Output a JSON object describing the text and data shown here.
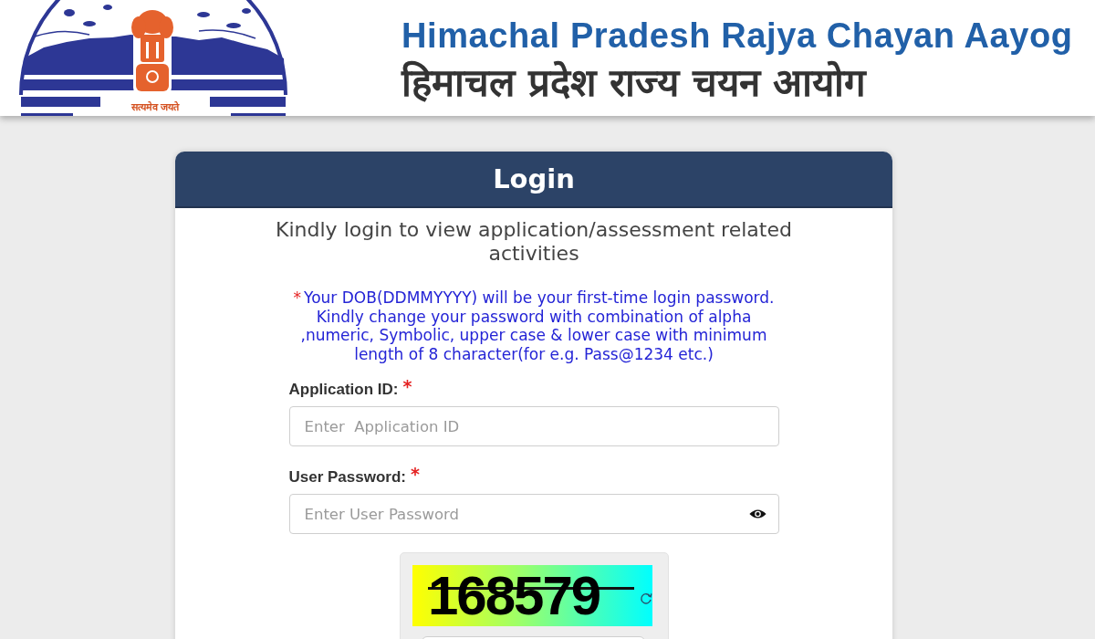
{
  "header": {
    "logo_motto": "सत्यमेव जयते",
    "title": "Himachal Pradesh Rajya Chayan Aayog",
    "title_hindi": "हिमाचल प्रदेश राज्य चयन आयोग"
  },
  "login_card": {
    "title": "Login",
    "subtitle": "Kindly login to view application/assessment related activities",
    "note": {
      "marker": "*",
      "text": "Your DOB(DDMMYYYY) will be your first-time login password. Kindly change your password with combination of alpha ,numeric, Symbolic, upper case & lower case with minimum length of 8 character(for e.g. Pass@1234 etc.)"
    },
    "fields": [
      {
        "kind": "text",
        "label": "Application ID:",
        "required_mark": "*",
        "placeholder": "Enter  Application ID"
      },
      {
        "kind": "password",
        "label": "User Password:",
        "required_mark": "*",
        "placeholder": "Enter User Password"
      }
    ],
    "captcha": {
      "code": "168579"
    }
  }
}
